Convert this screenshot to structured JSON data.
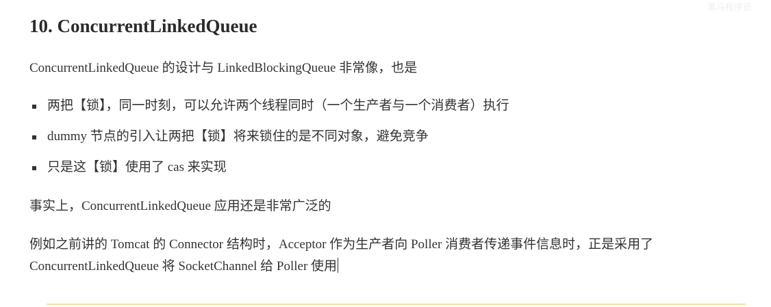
{
  "heading": "10. ConcurrentLinkedQueue",
  "intro": "ConcurrentLinkedQueue 的设计与 LinkedBlockingQueue 非常像，也是",
  "bullets": [
    "两把【锁】，同一时刻，可以允许两个线程同时（一个生产者与一个消费者）执行",
    "dummy 节点的引入让两把【锁】将来锁住的是不同对象，避免竞争",
    "只是这【锁】使用了 cas 来实现"
  ],
  "fact": "事实上，ConcurrentLinkedQueue 应用还是非常广泛的",
  "example": "例如之前讲的 Tomcat 的 Connector 结构时，Acceptor 作为生产者向 Poller 消费者传递事件信息时，正是采用了 ConcurrentLinkedQueue 将 SocketChannel 给 Poller 使用",
  "watermark": "黑马程序员"
}
